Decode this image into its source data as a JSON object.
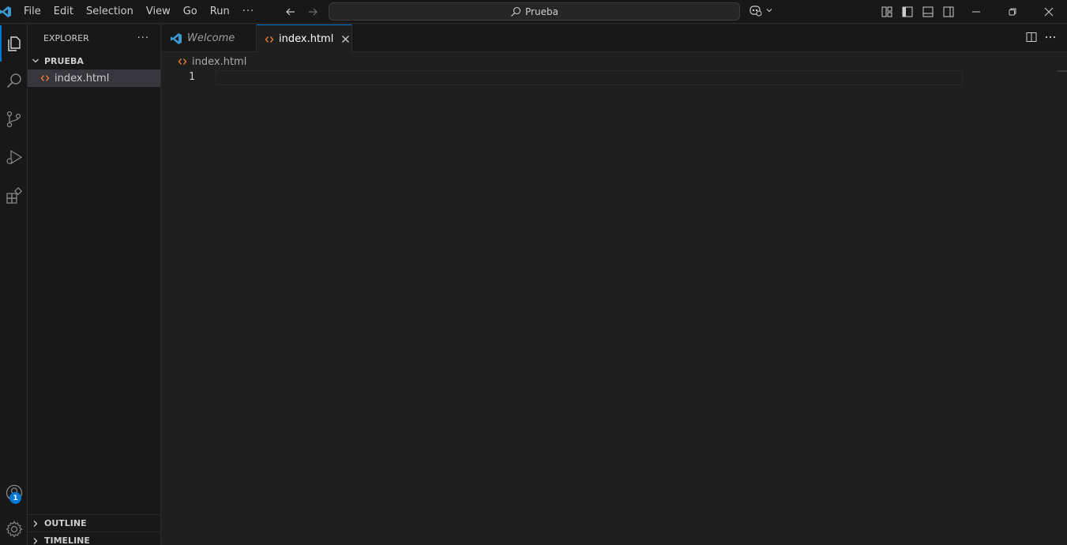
{
  "menu": {
    "items": [
      "File",
      "Edit",
      "Selection",
      "View",
      "Go",
      "Run"
    ],
    "more": "···"
  },
  "command_center": {
    "text": "Prueba"
  },
  "sidebar": {
    "title": "EXPLORER",
    "more": "···",
    "folder": "PRUEBA",
    "files": [
      {
        "name": "index.html"
      }
    ],
    "panels": [
      "OUTLINE",
      "TIMELINE"
    ]
  },
  "activity": {
    "accounts_badge": "1"
  },
  "tabs": [
    {
      "label": "Welcome",
      "active": false
    },
    {
      "label": "index.html",
      "active": true
    }
  ],
  "editor": {
    "breadcrumb": "index.html",
    "line_numbers": [
      "1"
    ]
  },
  "colors": {
    "accent": "#0078d4",
    "html_icon": "#e37933",
    "vscode_logo": "#3c99d4"
  }
}
